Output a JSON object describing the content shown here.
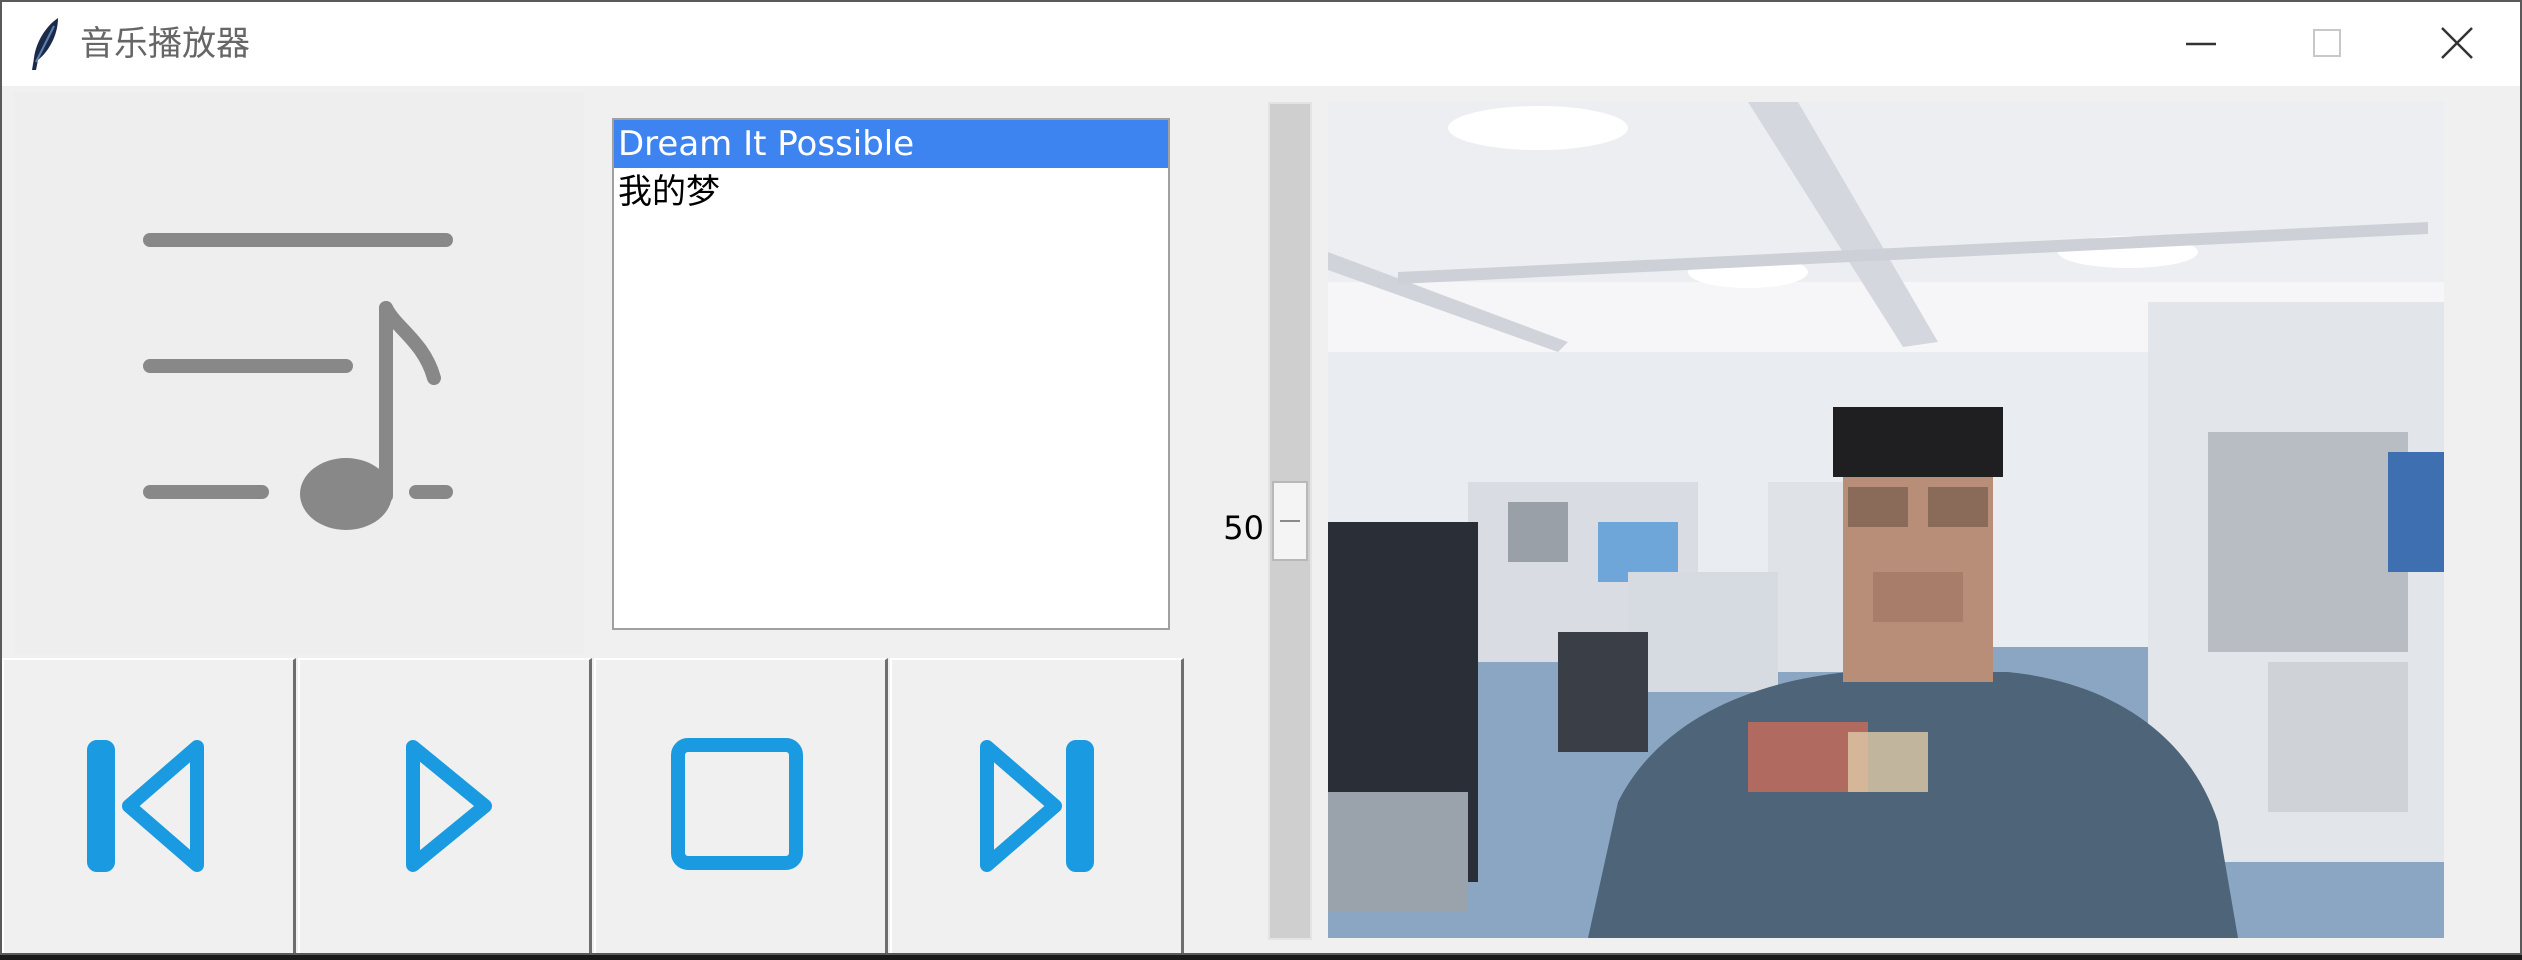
{
  "window": {
    "title": "音乐播放器",
    "app_icon": "feather-icon",
    "controls": [
      "minimize-icon",
      "maximize-icon",
      "close-icon"
    ]
  },
  "album_art": {
    "icon": "playlist-music-note-icon",
    "color": "#888888"
  },
  "playlist": {
    "items": [
      "Dream It Possible",
      "我的梦"
    ],
    "selected_index": 0,
    "selection_color": "#3d84f0"
  },
  "player_controls": {
    "icons": [
      "previous-track-icon",
      "play-icon",
      "stop-icon",
      "next-track-icon"
    ],
    "icon_color": "#1a9ae0"
  },
  "volume": {
    "value": "50",
    "min": 0,
    "max": 100
  },
  "camera_feed": {
    "content": "live-camera-preview"
  }
}
